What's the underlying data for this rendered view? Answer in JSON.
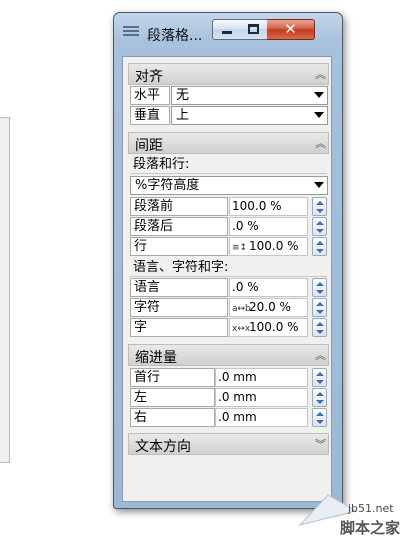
{
  "window": {
    "title": "段落格...",
    "minimize_glyph": "—",
    "maximize_glyph": "□",
    "close_glyph": "✕"
  },
  "sections": {
    "align": {
      "title": "对齐",
      "rows": [
        {
          "label": "水平",
          "value": "无"
        },
        {
          "label": "垂直",
          "value": "上"
        }
      ]
    },
    "spacing": {
      "title": "间距",
      "para_and_line_label": "段落和行:",
      "mode_value": "%字符高度",
      "rows": [
        {
          "label": "段落前",
          "value": "100.0 %",
          "icon": ""
        },
        {
          "label": "段落后",
          "value": ".0 %",
          "icon": ""
        },
        {
          "label": "行",
          "value": "100.0 %",
          "icon": "≡↕"
        }
      ],
      "lang_label": "语言、字符和字:",
      "rows2": [
        {
          "label": "语言",
          "value": ".0 %",
          "icon": ""
        },
        {
          "label": "字符",
          "value": "20.0 %",
          "icon": "a↔b"
        },
        {
          "label": "字",
          "value": "100.0 %",
          "icon": "x↔x"
        }
      ]
    },
    "indent": {
      "title": "缩进量",
      "rows": [
        {
          "label": "首行",
          "value": ".0 mm"
        },
        {
          "label": "左",
          "value": ".0 mm"
        },
        {
          "label": "右",
          "value": ".0 mm"
        }
      ]
    },
    "text_direction": {
      "title": "文本方向"
    }
  },
  "icons": {
    "app": "paragraph-format-icon",
    "collapse": "double-chevron-up-icon",
    "expand": "double-chevron-down-icon"
  },
  "watermark": {
    "url": "jb51.net",
    "name": "脚本之家"
  },
  "colors": {
    "close_button": "#c23b1d",
    "spinner_arrow": "#3c6fb2",
    "section_header": "#d8d8d8"
  }
}
